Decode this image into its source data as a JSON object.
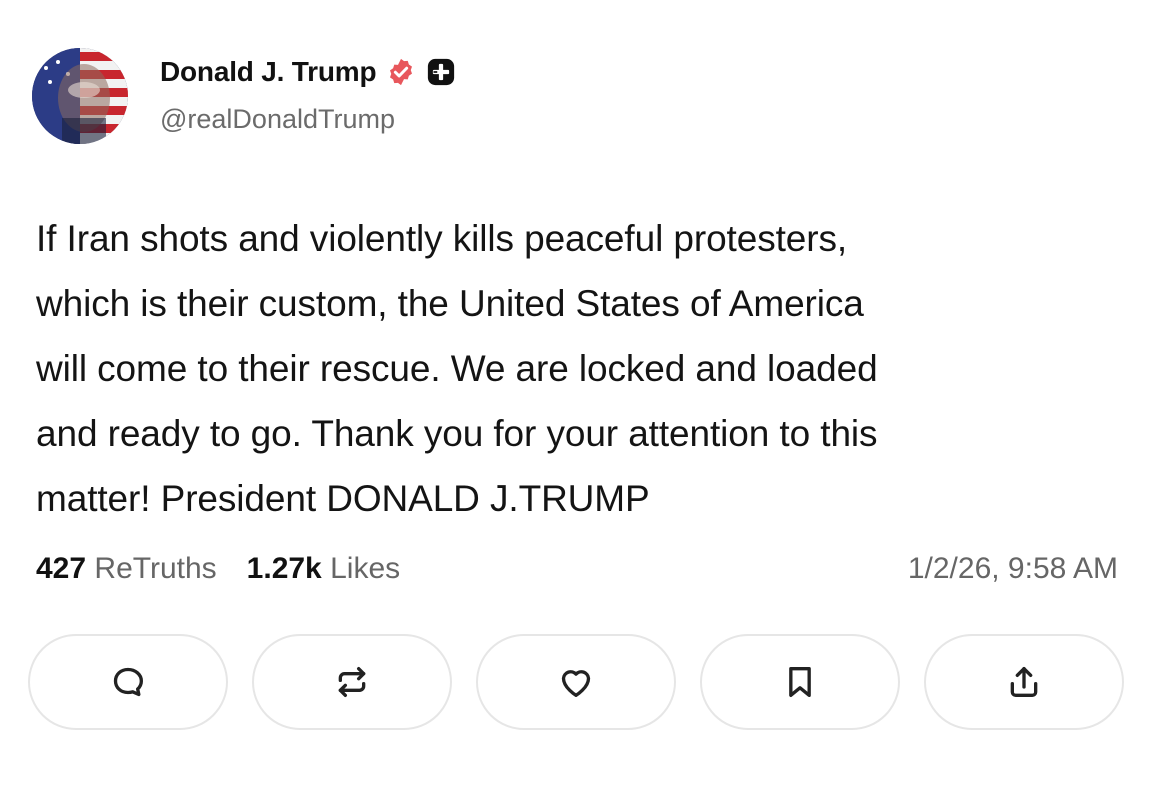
{
  "author": {
    "display_name": "Donald J. Trump",
    "handle": "@realDonaldTrump",
    "verified": true,
    "plus_badge": true
  },
  "post": {
    "lines": [
      "If Iran shots and violently kills peaceful protesters,",
      "which is their custom, the United States of America",
      "will come to their rescue. We are locked and loaded",
      "and ready to go. Thank you for your attention to this",
      "matter! President DONALD J.TRUMP"
    ]
  },
  "stats": {
    "retruths_count": "427",
    "retruths_label": "ReTruths",
    "likes_count": "1.27k",
    "likes_label": "Likes",
    "timestamp": "1/2/26, 9:58 AM"
  },
  "actions": [
    {
      "icon": "reply-icon"
    },
    {
      "icon": "retruth-icon"
    },
    {
      "icon": "like-icon"
    },
    {
      "icon": "bookmark-icon"
    },
    {
      "icon": "share-icon"
    }
  ],
  "colors": {
    "verified_badge": "#e8575c",
    "plus_badge": "#111111",
    "muted_text": "#666666"
  }
}
